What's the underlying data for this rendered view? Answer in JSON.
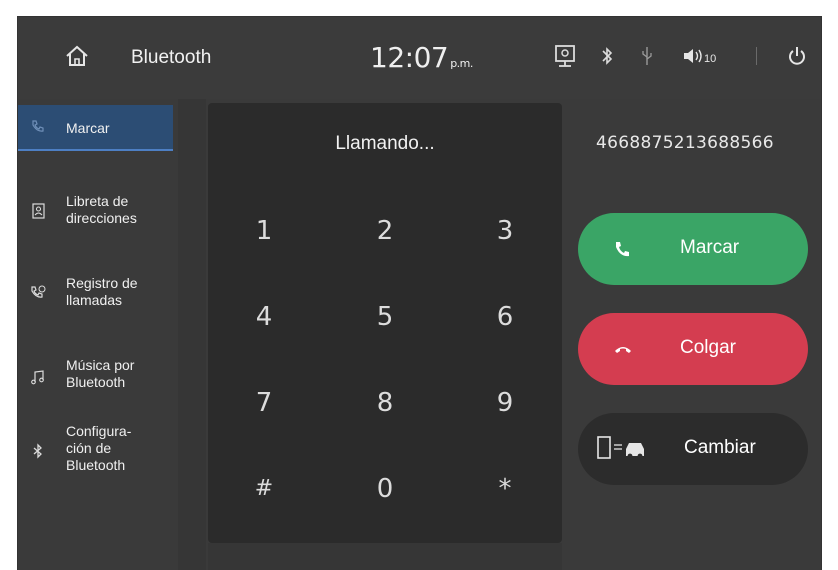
{
  "header": {
    "title": "Bluetooth",
    "time": "12:07",
    "ampm": "p.m.",
    "volume_level": "10",
    "icons": [
      "home-icon",
      "projection-icon",
      "bluetooth-icon",
      "usb-icon",
      "volume-icon",
      "power-icon"
    ]
  },
  "sidebar": {
    "items": [
      {
        "label_line1": "Marcar",
        "label_line2": "",
        "label_line3": "",
        "icon": "phone-dial-icon",
        "active": true
      },
      {
        "label_line1": "Libreta de",
        "label_line2": "direcciones",
        "label_line3": "",
        "icon": "contacts-icon",
        "active": false
      },
      {
        "label_line1": "Registro de",
        "label_line2": "llamadas",
        "label_line3": "",
        "icon": "call-log-icon",
        "active": false
      },
      {
        "label_line1": "Música por",
        "label_line2": "Bluetooth",
        "label_line3": "",
        "icon": "music-icon",
        "active": false
      },
      {
        "label_line1": "Configura-",
        "label_line2": "ción de",
        "label_line3": "Bluetooth",
        "icon": "bluetooth-settings-icon",
        "active": false
      }
    ]
  },
  "dialer": {
    "status": "Llamando...",
    "keys": [
      "1",
      "2",
      "3",
      "4",
      "5",
      "6",
      "7",
      "8",
      "9",
      "#",
      "0",
      "*"
    ]
  },
  "call_panel": {
    "number": "4668875213688566",
    "call_label": "Marcar",
    "hangup_label": "Colgar",
    "switch_label": "Cambiar"
  },
  "colors": {
    "call_button": "#3aa566",
    "hangup_button": "#d43d50",
    "active_sidebar": "#2c4d74"
  }
}
